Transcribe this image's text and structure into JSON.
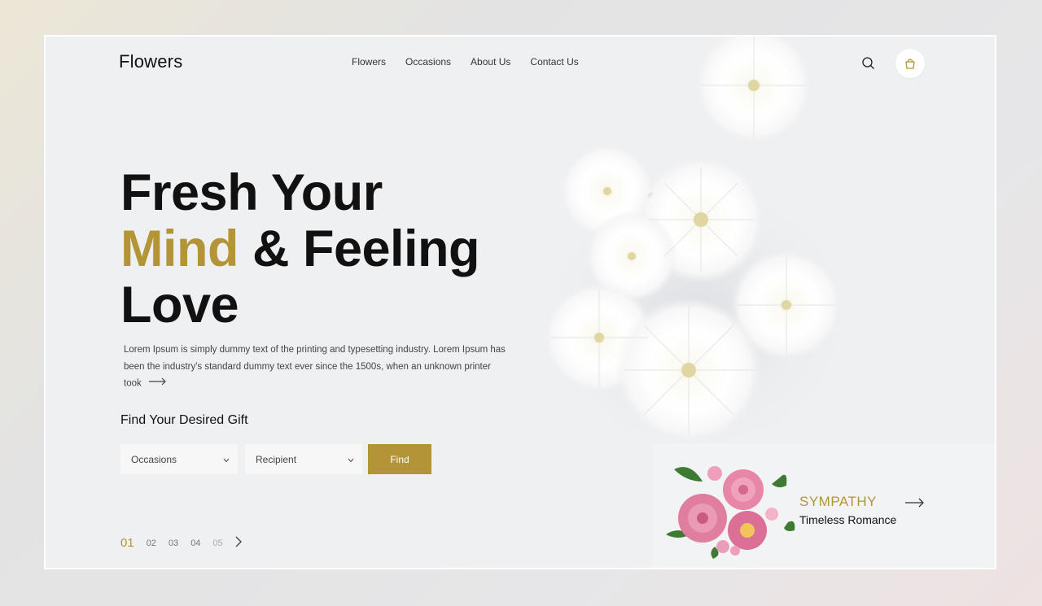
{
  "brand": {
    "name": "Flowers"
  },
  "nav": [
    {
      "label": "Flowers"
    },
    {
      "label": "Occasions"
    },
    {
      "label": "About Us"
    },
    {
      "label": "Contact Us"
    }
  ],
  "header": {
    "search_icon": "search-icon",
    "cart_icon": "shopping-bag-icon"
  },
  "hero": {
    "line1": "Fresh Your",
    "line2_gold": "Mind",
    "line2_rest": " & Feeling",
    "line3": "Love",
    "body": "Lorem Ipsum is simply dummy text of the printing and typesetting industry. Lorem Ipsum has been the industry's standard dummy text ever since the 1500s, when an unknown printer took"
  },
  "gift_finder": {
    "title": "Find Your Desired Gift",
    "occasions_value": "Occasions",
    "recipient_value": "Recipient",
    "find_label": "Find"
  },
  "pagination": {
    "pages": [
      "01",
      "02",
      "03",
      "04",
      "05"
    ],
    "active": "01"
  },
  "promo": {
    "eyebrow": "SYMPATHY",
    "title": "Timeless Romance"
  },
  "colors": {
    "accent": "#b39436",
    "text": "#111111",
    "frame_bg": "#eff0f2"
  }
}
